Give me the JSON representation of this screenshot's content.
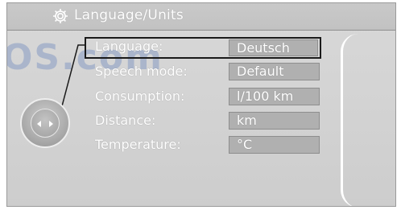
{
  "header": {
    "title": "Language/Units",
    "icon": "gear-icon"
  },
  "watermark": "OS.com",
  "settings": [
    {
      "label": "Language:",
      "value": "Deutsch",
      "selected": true
    },
    {
      "label": "Speech mode:",
      "value": "Default",
      "selected": false
    },
    {
      "label": "Consumption:",
      "value": "l/100 km",
      "selected": false
    },
    {
      "label": "Distance:",
      "value": "km",
      "selected": false
    },
    {
      "label": "Temperature:",
      "value": "°C",
      "selected": false
    }
  ],
  "colors": {
    "panel_bg": "#d3d3d3",
    "value_box": "#b0b0b0",
    "text": "#ffffff",
    "selection_frame": "#1a1a1a"
  }
}
